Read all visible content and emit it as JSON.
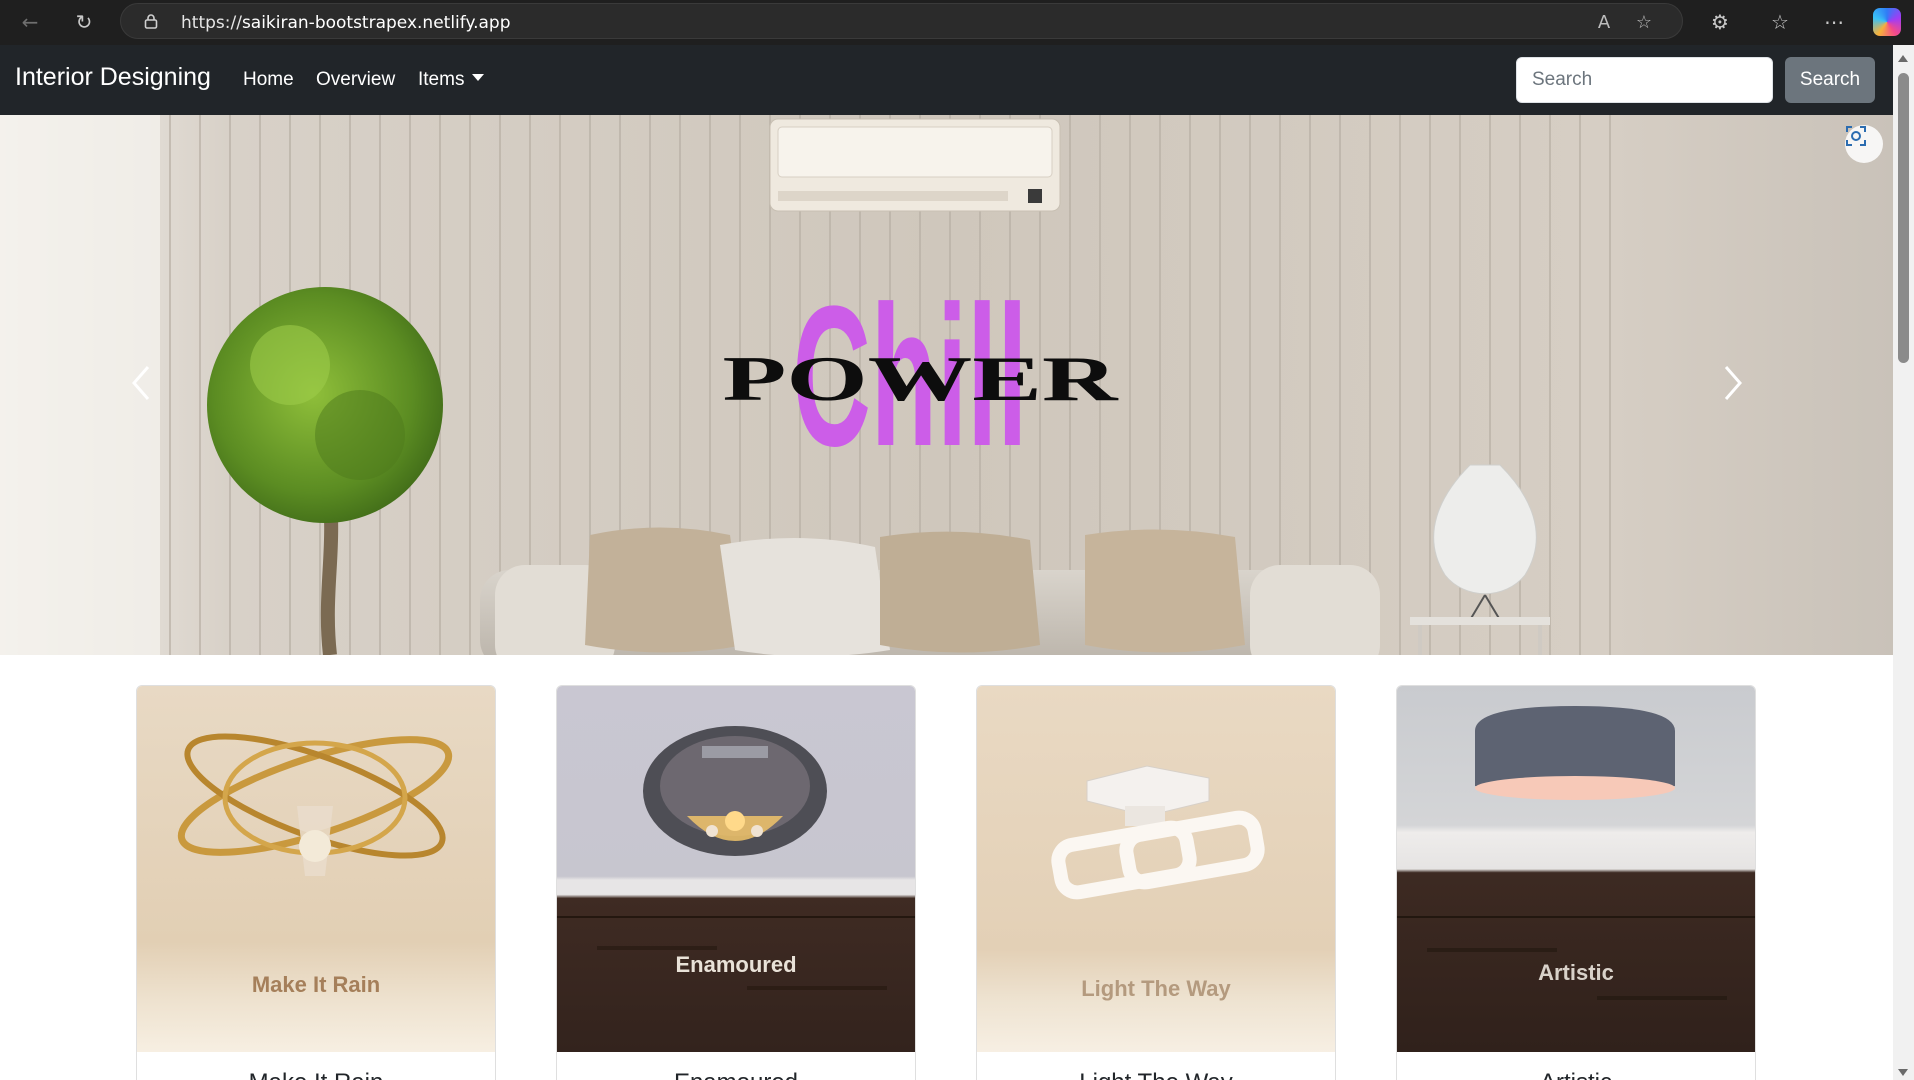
{
  "browser": {
    "url_prefix": "https://",
    "url_host": "saikiran-bootstrapex.netlify.app"
  },
  "navbar": {
    "brand": "Interior Designing",
    "links": [
      "Home",
      "Overview",
      "Items"
    ],
    "search_placeholder": "Search",
    "search_button": "Search"
  },
  "hero": {
    "logo_word_1": "POWER",
    "logo_word_2": "Chill",
    "logo_color": "#cc5de8"
  },
  "cards": [
    {
      "image_label": "Make It Rain",
      "title": "Make It Rain"
    },
    {
      "image_label": "Enamoured",
      "title": "Enamoured"
    },
    {
      "image_label": "Light The Way",
      "title": "Light The Way"
    },
    {
      "image_label": "Artistic",
      "title": "Artistic"
    }
  ],
  "colors": {
    "navbar_bg": "#212529",
    "search_button_bg": "#6c757d"
  }
}
